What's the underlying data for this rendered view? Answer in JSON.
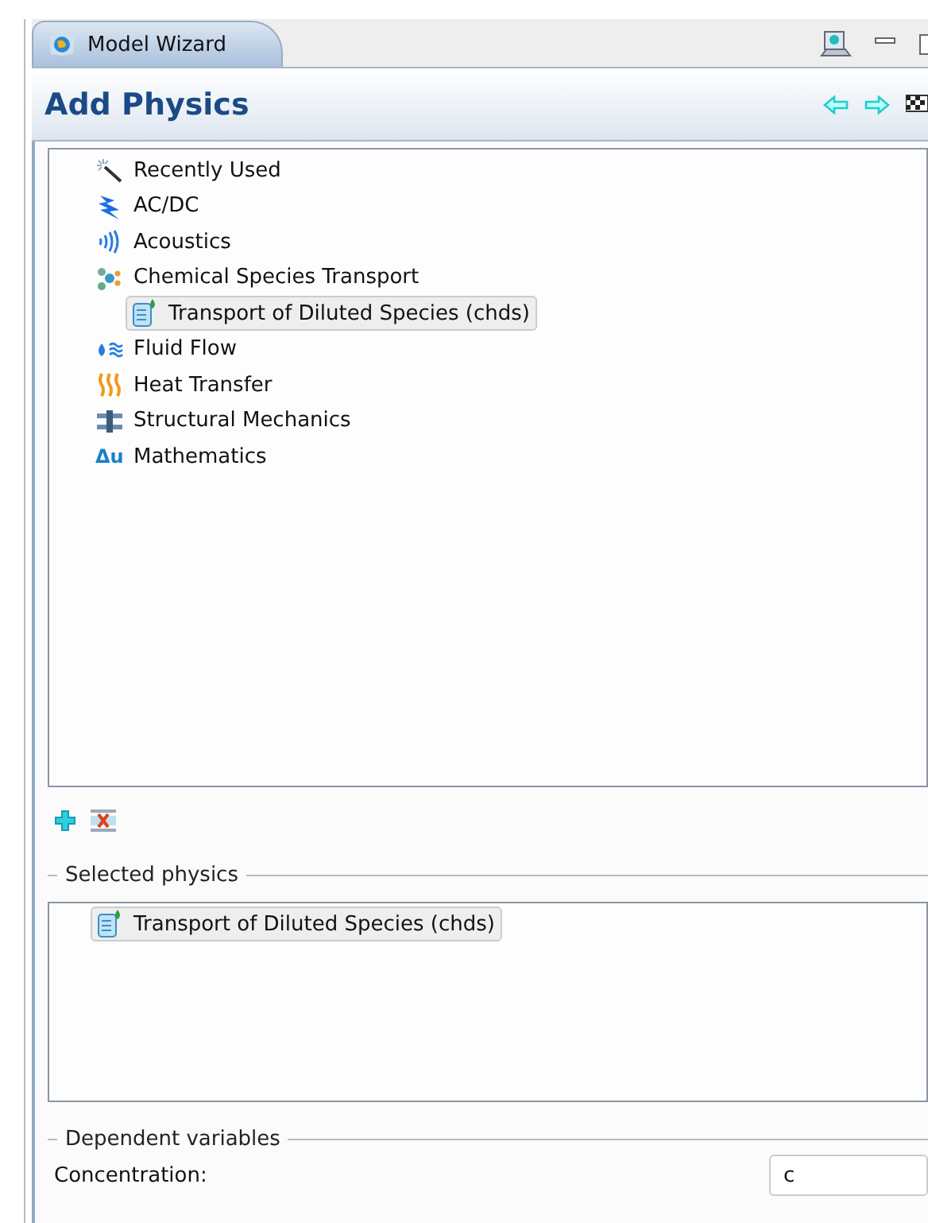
{
  "tab": {
    "title": "Model Wizard"
  },
  "header": {
    "title": "Add Physics"
  },
  "tree": {
    "items": [
      {
        "label": "Recently Used",
        "kind": "recent",
        "selected": false
      },
      {
        "label": "AC/DC",
        "kind": "acdc",
        "selected": false
      },
      {
        "label": "Acoustics",
        "kind": "acoustics",
        "selected": false
      },
      {
        "label": "Chemical Species Transport",
        "kind": "chemical",
        "selected": false,
        "children": [
          {
            "label": "Transport of Diluted Species (chds)",
            "kind": "species",
            "selected": true
          }
        ]
      },
      {
        "label": "Fluid Flow",
        "kind": "fluid",
        "selected": false
      },
      {
        "label": "Heat Transfer",
        "kind": "heat",
        "selected": false
      },
      {
        "label": "Structural Mechanics",
        "kind": "structural",
        "selected": false
      },
      {
        "label": "Mathematics",
        "kind": "math",
        "icon_text": "Δu",
        "selected": false
      }
    ]
  },
  "selected_physics": {
    "title": "Selected physics",
    "items": [
      {
        "label": "Transport of Diluted Species (chds)",
        "kind": "species",
        "selected": true
      }
    ]
  },
  "dependent_variables": {
    "title": "Dependent variables",
    "fields": [
      {
        "label": "Concentration:",
        "value": "c"
      }
    ]
  }
}
